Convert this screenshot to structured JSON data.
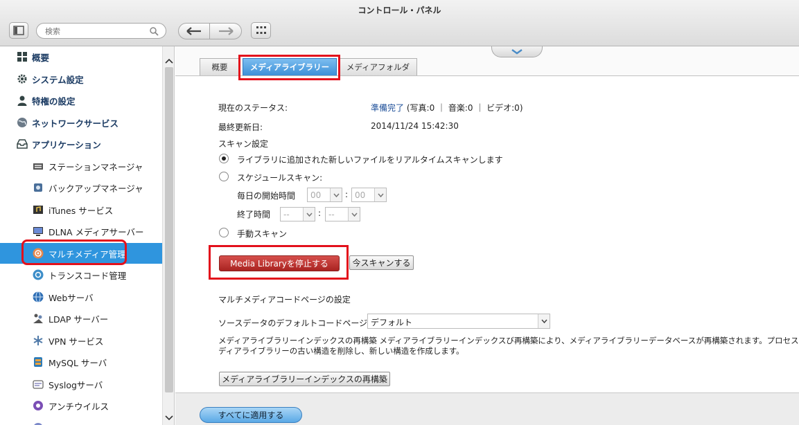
{
  "window": {
    "title": "コントロール・パネル"
  },
  "toolbar": {
    "search_placeholder": "検索"
  },
  "sidebar": {
    "items": [
      {
        "label": "概要",
        "level": 1,
        "icon": "grid-icon"
      },
      {
        "label": "システム設定",
        "level": 1,
        "icon": "gear-icon"
      },
      {
        "label": "特権の設定",
        "level": 1,
        "icon": "user-icon"
      },
      {
        "label": "ネットワークサービス",
        "level": 1,
        "icon": "globe-icon"
      },
      {
        "label": "アプリケーション",
        "level": 1,
        "icon": "tray-icon"
      },
      {
        "label": "ステーションマネージャ",
        "level": 2,
        "icon": "station-icon"
      },
      {
        "label": "バックアップマネージャ",
        "level": 2,
        "icon": "backup-icon"
      },
      {
        "label": "iTunes サービス",
        "level": 2,
        "icon": "itunes-icon"
      },
      {
        "label": "DLNA メディアサーバー",
        "level": 2,
        "icon": "dlna-icon"
      },
      {
        "label": "マルチメディア管理",
        "level": 2,
        "icon": "multimedia-icon",
        "selected": true
      },
      {
        "label": "トランスコード管理",
        "level": 2,
        "icon": "transcode-icon"
      },
      {
        "label": "Webサーバ",
        "level": 2,
        "icon": "web-icon"
      },
      {
        "label": "LDAP サーバー",
        "level": 2,
        "icon": "ldap-icon"
      },
      {
        "label": "VPN サービス",
        "level": 2,
        "icon": "vpn-icon"
      },
      {
        "label": "MySQL サーバ",
        "level": 2,
        "icon": "mysql-icon"
      },
      {
        "label": "Syslogサーバ",
        "level": 2,
        "icon": "syslog-icon"
      },
      {
        "label": "アンチウイルス",
        "level": 2,
        "icon": "antivirus-icon"
      }
    ]
  },
  "tabs": [
    {
      "label": "概要"
    },
    {
      "label": "メディアライブラリー",
      "active": true
    },
    {
      "label": "メディアフォルダ"
    }
  ],
  "status": {
    "label": "現在のステータス:",
    "value_link": "準備完了",
    "value_rest": "(写真:0 ｜ 音楽:0 ｜ ビデオ:0)"
  },
  "last_update": {
    "label": "最終更新日:",
    "value": "2014/11/24 15:42:30"
  },
  "scan": {
    "title": "スキャン設定",
    "realtime_label": "ライブラリに追加された新しいファイルをリアルタイムスキャンします",
    "schedule_label": "スケジュールスキャン:",
    "start_label": "毎日の開始時間",
    "start_hour": "00",
    "start_min": "00",
    "end_label": "終了時間",
    "end_hour": "--",
    "end_min": "--",
    "manual_label": "手動スキャン",
    "selected": "realtime"
  },
  "buttons": {
    "stop": "Media Libraryを停止する",
    "scan_now": "今スキャンする",
    "rebuild": "メディアライブラリーインデックスの再構築",
    "apply_all": "すべてに適用する"
  },
  "codepage": {
    "title": "マルチメディアコードページの設定",
    "label": "ソースデータのデフォルトコードページ:",
    "value": "デフォルト"
  },
  "rebuild_desc": {
    "line1": "メディアライブラリーインデックスの再構築 メディアライブラリーインデックスび再構築により、メディアライブラリーデータベースが再構築されます。プロセスはメ",
    "line2": "ディアライブラリーの古い構造を削除し、新しい構造を作成します。"
  },
  "colors": {
    "selected": "#2f95de",
    "highlight": "#e3101b",
    "stop_button": "#b52c29"
  }
}
